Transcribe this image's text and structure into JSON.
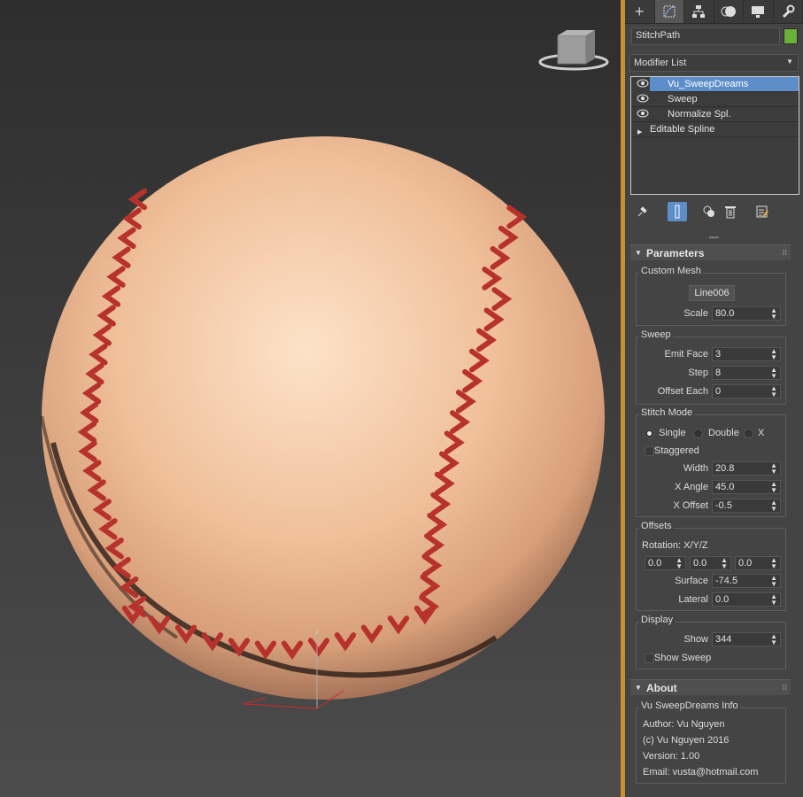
{
  "command_panel": {
    "tabs": [
      {
        "name": "create",
        "glyph": "+"
      },
      {
        "name": "modify",
        "glyph": "⌗"
      },
      {
        "name": "hierarchy",
        "glyph": "⊓"
      },
      {
        "name": "motion",
        "glyph": "◐"
      },
      {
        "name": "display",
        "glyph": "▭"
      },
      {
        "name": "utilities",
        "glyph": "🔧"
      }
    ],
    "active_tab": "modify",
    "object_name": "StitchPath",
    "object_color": "#6ab13c",
    "modifier_list_label": "Modifier List",
    "stack": [
      {
        "label": "Vu_SweepDreams",
        "selected": true
      },
      {
        "label": "Sweep",
        "selected": false
      },
      {
        "label": "Normalize Spl.",
        "selected": false
      },
      {
        "label": "Editable Spline",
        "selected": false
      }
    ]
  },
  "parameters": {
    "title": "Parameters",
    "custom_mesh": {
      "title": "Custom Mesh",
      "pick_button": "Line006",
      "scale_label": "Scale",
      "scale_value": "80.0"
    },
    "sweep": {
      "title": "Sweep",
      "emit_face_label": "Emit Face",
      "emit_face_value": "3",
      "step_label": "Step",
      "step_value": "8",
      "offset_each_label": "Offset Each",
      "offset_each_value": "0"
    },
    "stitch_mode": {
      "title": "Stitch Mode",
      "single": "Single",
      "double": "Double",
      "x": "X",
      "selected": "Single",
      "staggered": "Staggered",
      "width_label": "Width",
      "width_value": "20.8",
      "x_angle_label": "X Angle",
      "x_angle_value": "45.0",
      "x_offset_label": "X Offset",
      "x_offset_value": "-0.5"
    },
    "offsets": {
      "title": "Offsets",
      "rotation_label": "Rotation: X/Y/Z",
      "rot_x": "0.0",
      "rot_y": "0.0",
      "rot_z": "0.0",
      "surface_label": "Surface",
      "surface_value": "-74.5",
      "lateral_label": "Lateral",
      "lateral_value": "0.0"
    },
    "display": {
      "title": "Display",
      "show_label": "Show",
      "show_value": "344",
      "show_sweep": "Show Sweep"
    }
  },
  "about": {
    "title": "About",
    "group_title": "Vu SweepDreams Info",
    "author": "Author: Vu Nguyen",
    "copyright": "(c) Vu Nguyen 2016",
    "version": "Version: 1.00",
    "email": "Email: vusta@hotmail.com"
  },
  "viewport": {
    "gizmo_z_label": "z",
    "accent_stitch_color": "#b7322d",
    "ball_color": "#f2c6a2"
  }
}
